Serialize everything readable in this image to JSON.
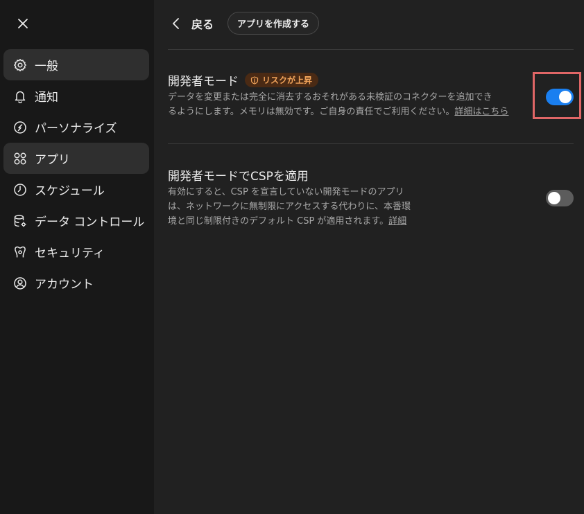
{
  "sidebar": {
    "items": [
      {
        "label": "一般",
        "icon": "gear-icon",
        "active": true
      },
      {
        "label": "通知",
        "icon": "bell-icon",
        "active": false
      },
      {
        "label": "パーソナライズ",
        "icon": "personalize-icon",
        "active": false
      },
      {
        "label": "アプリ",
        "icon": "apps-grid-icon",
        "active": true
      },
      {
        "label": "スケジュール",
        "icon": "clock-icon",
        "active": false
      },
      {
        "label": "データ コントロール",
        "icon": "database-gear-icon",
        "active": false
      },
      {
        "label": "セキュリティ",
        "icon": "security-icon",
        "active": false
      },
      {
        "label": "アカウント",
        "icon": "account-icon",
        "active": false
      }
    ]
  },
  "header": {
    "back_label": "戻る",
    "create_app_label": "アプリを作成する"
  },
  "settings": {
    "developer_mode": {
      "title": "開発者モード",
      "badge": "リスクが上昇",
      "desc_line1": "データを変更または完全に消去するおそれがある未検証のコネクターを追加でき",
      "desc_line2": "るようにします。メモリは無効です。ご自身の責任でご利用ください。",
      "link": "詳細はこちら",
      "enabled": true
    },
    "csp": {
      "title": "開発者モードでCSPを適用",
      "desc_line1": "有効にすると、CSP を宣言していない開発モードのアプリ",
      "desc_line2": "は、ネットワークに無制限にアクセスする代わりに、本番環",
      "desc_line3": "境と同じ制限付きのデフォルト CSP が適用されます。",
      "link": "詳細",
      "enabled": false
    }
  },
  "colors": {
    "toggle_on": "#1a7ff0",
    "badge_text": "#f0a35a",
    "highlight": "#e06666"
  }
}
